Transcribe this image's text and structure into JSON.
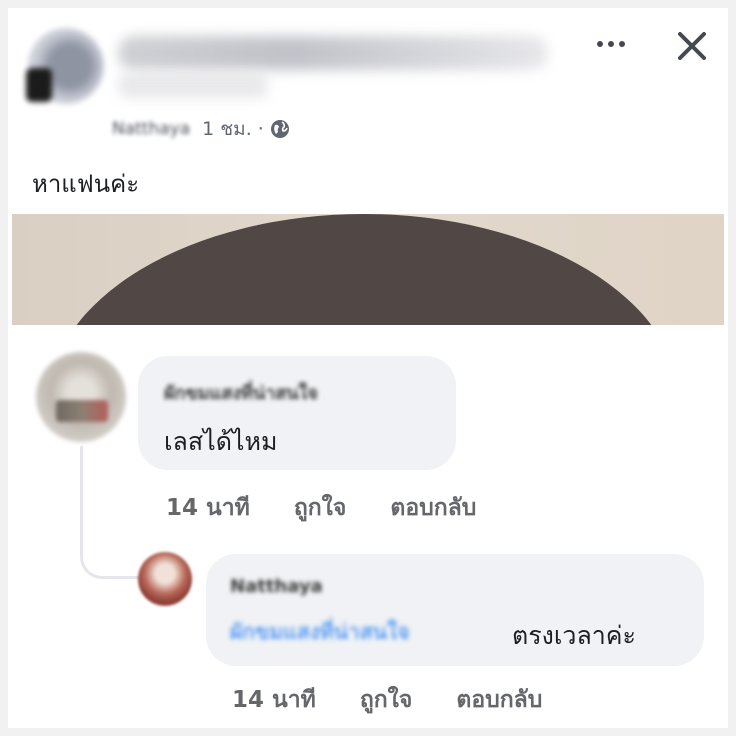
{
  "post": {
    "author_name_blurred": "Natthaya",
    "timestamp": "1 ชม.",
    "separator": "·",
    "privacy_icon": "globe-icon",
    "text": "หาแฟนค่ะ"
  },
  "header": {
    "more_icon": "more-horizontal-icon",
    "close_icon": "close-icon"
  },
  "comments": [
    {
      "author_blurred": "ผักขมแสงที่น่าสนใจ",
      "text": "เลสได้ไหม",
      "time": "14 นาที",
      "like_label": "ถูกใจ",
      "reply_label": "ตอบกลับ"
    },
    {
      "author_blurred": "Natthaya",
      "mention_blurred": "ผักขมแสงที่น่าสนใจ",
      "text": "ตรงเวลาค่ะ",
      "time": "14 นาที",
      "like_label": "ถูกใจ",
      "reply_label": "ตอบกลับ"
    }
  ],
  "colors": {
    "bubble": "#f0f2f5",
    "meta_text": "#65676b",
    "mention": "#1877f2"
  }
}
